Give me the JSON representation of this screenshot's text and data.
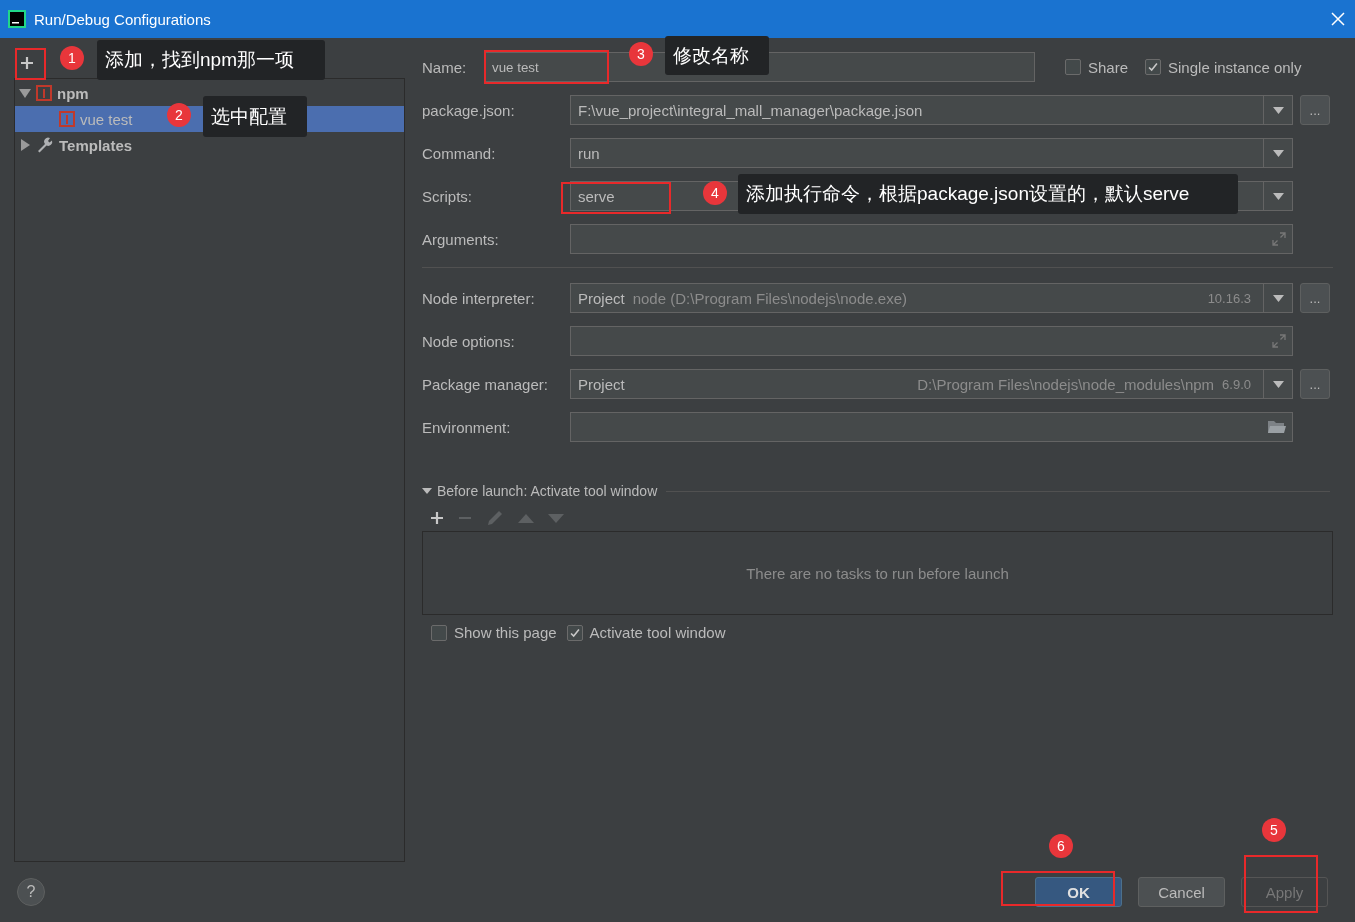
{
  "window": {
    "title": "Run/Debug Configurations"
  },
  "tree": [
    {
      "label": "npm",
      "kind": "npm",
      "expanded": true,
      "selected": false,
      "children": [
        {
          "label": "vue test",
          "kind": "npm",
          "selected": true
        }
      ]
    },
    {
      "label": "Templates",
      "kind": "templates",
      "expanded": false,
      "selected": false
    }
  ],
  "form": {
    "name": {
      "label": "Name:",
      "value": "vue test"
    },
    "options": [
      {
        "label": "Share",
        "checked": false
      },
      {
        "label": "Single instance only",
        "checked": true
      }
    ],
    "fields": [
      {
        "kind": "combo",
        "label": "package.json:",
        "value": "F:\\vue_project\\integral_mall_manager\\package.json",
        "browse": "..."
      },
      {
        "kind": "combo",
        "label": "Command:",
        "value": "run"
      },
      {
        "kind": "combo",
        "label": "Scripts:",
        "value": "serve"
      },
      {
        "kind": "expand",
        "label": "Arguments:"
      },
      {
        "kind": "separator"
      },
      {
        "kind": "combo",
        "label": "Node interpreter:",
        "value": "Project",
        "detail": "node (D:\\Program Files\\nodejs\\node.exe)",
        "version": "10.16.3",
        "browse": "..."
      },
      {
        "kind": "expand",
        "label": "Node options:"
      },
      {
        "kind": "combo",
        "label": "Package manager:",
        "value": "Project",
        "path": "D:\\Program Files\\nodejs\\node_modules\\npm",
        "version": "6.9.0",
        "browse": "..."
      },
      {
        "kind": "folder",
        "label": "Environment:"
      }
    ]
  },
  "before_launch": {
    "title": "Before launch: Activate tool window",
    "expanded": true,
    "toolbar": [
      {
        "kind": "add",
        "disabled": false
      },
      {
        "kind": "remove",
        "disabled": true
      },
      {
        "kind": "edit",
        "disabled": true
      },
      {
        "kind": "up",
        "disabled": true
      },
      {
        "kind": "down",
        "disabled": true
      }
    ],
    "empty_text": "There are no tasks to run before launch",
    "options": [
      {
        "label": "Show this page",
        "checked": false
      },
      {
        "label": "Activate tool window",
        "checked": true
      }
    ]
  },
  "help": "?",
  "buttons": [
    {
      "label": "OK",
      "kind": "default",
      "disabled": false
    },
    {
      "label": "Cancel",
      "kind": "normal",
      "disabled": false
    },
    {
      "label": "Apply",
      "kind": "normal",
      "disabled": true
    }
  ],
  "annotations": [
    {
      "number": "1",
      "text": "添加，找到npm那一项"
    },
    {
      "number": "2",
      "text": "选中配置"
    },
    {
      "number": "3",
      "text": "修改名称"
    },
    {
      "number": "4",
      "text": "添加执行命令，根据package.json设置的，默认serve"
    },
    {
      "number": "5"
    },
    {
      "number": "6"
    }
  ]
}
